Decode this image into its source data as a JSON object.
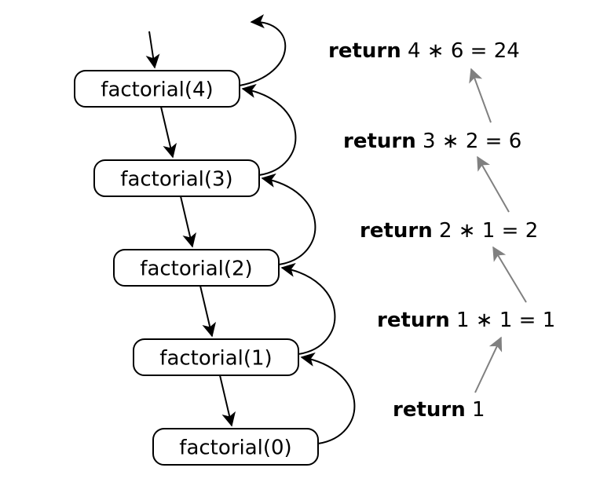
{
  "nodes": [
    {
      "label": "factorial(4)"
    },
    {
      "label": "factorial(3)"
    },
    {
      "label": "factorial(2)"
    },
    {
      "label": "factorial(1)"
    },
    {
      "label": "factorial(0)"
    }
  ],
  "returns": [
    {
      "kw": "return",
      "expr": " 4 ∗ 6 = 24"
    },
    {
      "kw": "return",
      "expr": " 3 ∗ 2 = 6"
    },
    {
      "kw": "return",
      "expr": " 2 ∗ 1 = 2"
    },
    {
      "kw": "return",
      "expr": " 1 ∗ 1 = 1"
    },
    {
      "kw": "return",
      "expr": " 1"
    }
  ]
}
